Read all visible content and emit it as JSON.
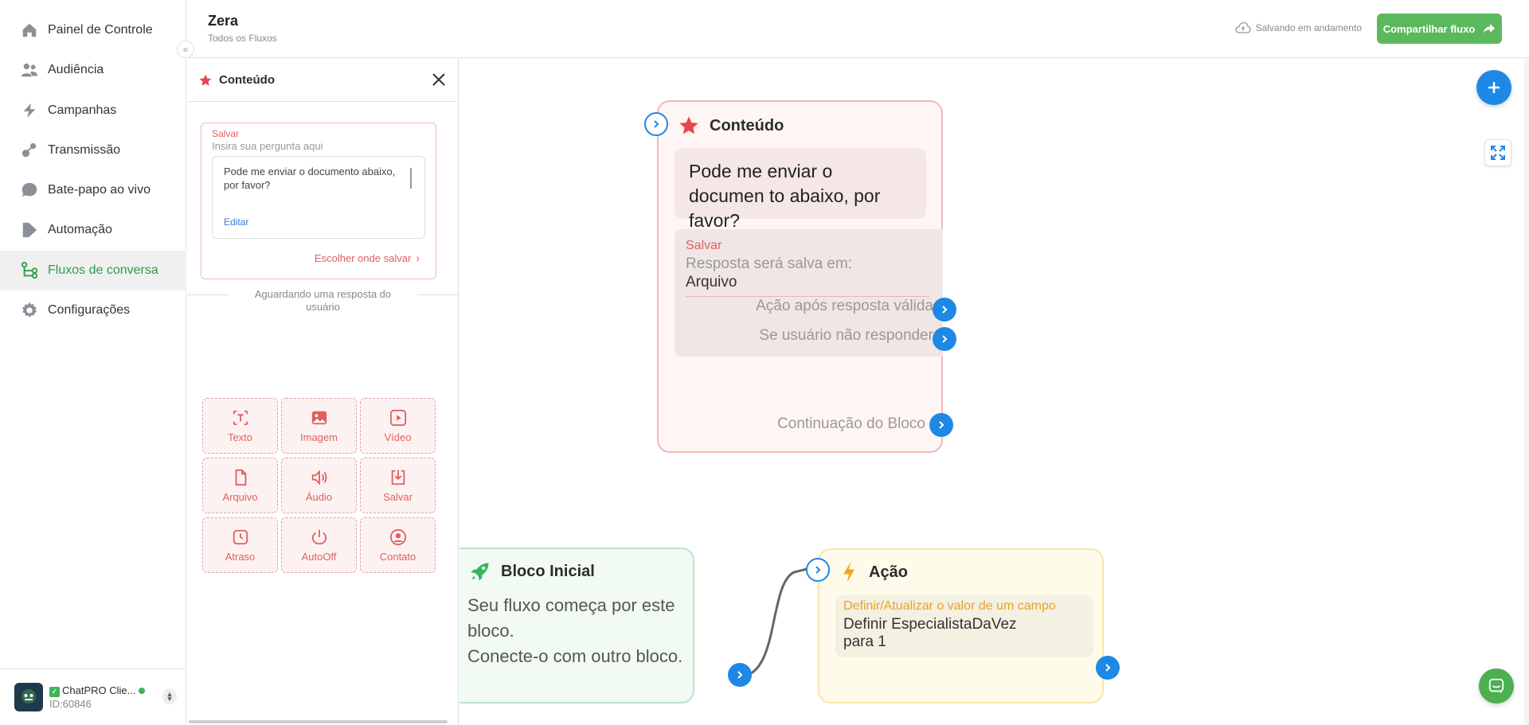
{
  "sidebar": {
    "items": [
      {
        "label": "Painel de Controle",
        "icon": "home-icon"
      },
      {
        "label": "Audiência",
        "icon": "users-icon"
      },
      {
        "label": "Campanhas",
        "icon": "campaign-icon"
      },
      {
        "label": "Transmissão",
        "icon": "broadcast-icon"
      },
      {
        "label": "Bate-papo ao vivo",
        "icon": "chat-bubble-icon"
      },
      {
        "label": "Automação",
        "icon": "automation-icon"
      },
      {
        "label": "Fluxos de conversa",
        "icon": "flow-icon"
      },
      {
        "label": "Configurações",
        "icon": "gear-icon"
      }
    ],
    "active_index": 6,
    "account": {
      "name": "ChatPRO Clie...",
      "id": "ID:60846"
    }
  },
  "header": {
    "title": "Zera",
    "breadcrumb": "Todos os Fluxos",
    "status": "Salvando em andamento",
    "share_label": "Compartilhar fluxo"
  },
  "panel": {
    "title": "Conteúdo",
    "save_label": "Salvar",
    "placeholder": "Insira sua pergunta aqui",
    "question": "Pode me enviar o documento abaixo, por favor?",
    "edit_label": "Editar",
    "choose_label": "Escolher onde salvar",
    "waiting": "Aguardando uma resposta do usuário",
    "tools": [
      "Texto",
      "Imagem",
      "Vídeo",
      "Arquivo",
      "Áudio",
      "Salvar",
      "Atraso",
      "AutoOff",
      "Contato"
    ]
  },
  "canvas": {
    "content_node": {
      "title": "Conteúdo",
      "message": "Pode me enviar o documen to abaixo, por favor?",
      "save_label": "Salvar",
      "save_desc": "Resposta será salva em:",
      "save_value": "Arquivo",
      "valid_action": "Ação após resposta válida",
      "no_reply": "Se usuário não responder",
      "continuation": "Continuação do Bloco"
    },
    "start_node": {
      "title": "Bloco Inicial",
      "desc_line1": "Seu fluxo começa por este bloco.",
      "desc_line2": "Conecte-o com outro bloco."
    },
    "action_node": {
      "title": "Ação",
      "label": "Definir/Atualizar o valor de um campo",
      "value_line1": "Definir EspecialistaDaVez",
      "value_line2": "para 1"
    }
  },
  "colors": {
    "accent_green": "#5cb85c",
    "accent_blue": "#1e88e5",
    "content_red": "#e06060",
    "action_yellow": "#e6a423"
  }
}
